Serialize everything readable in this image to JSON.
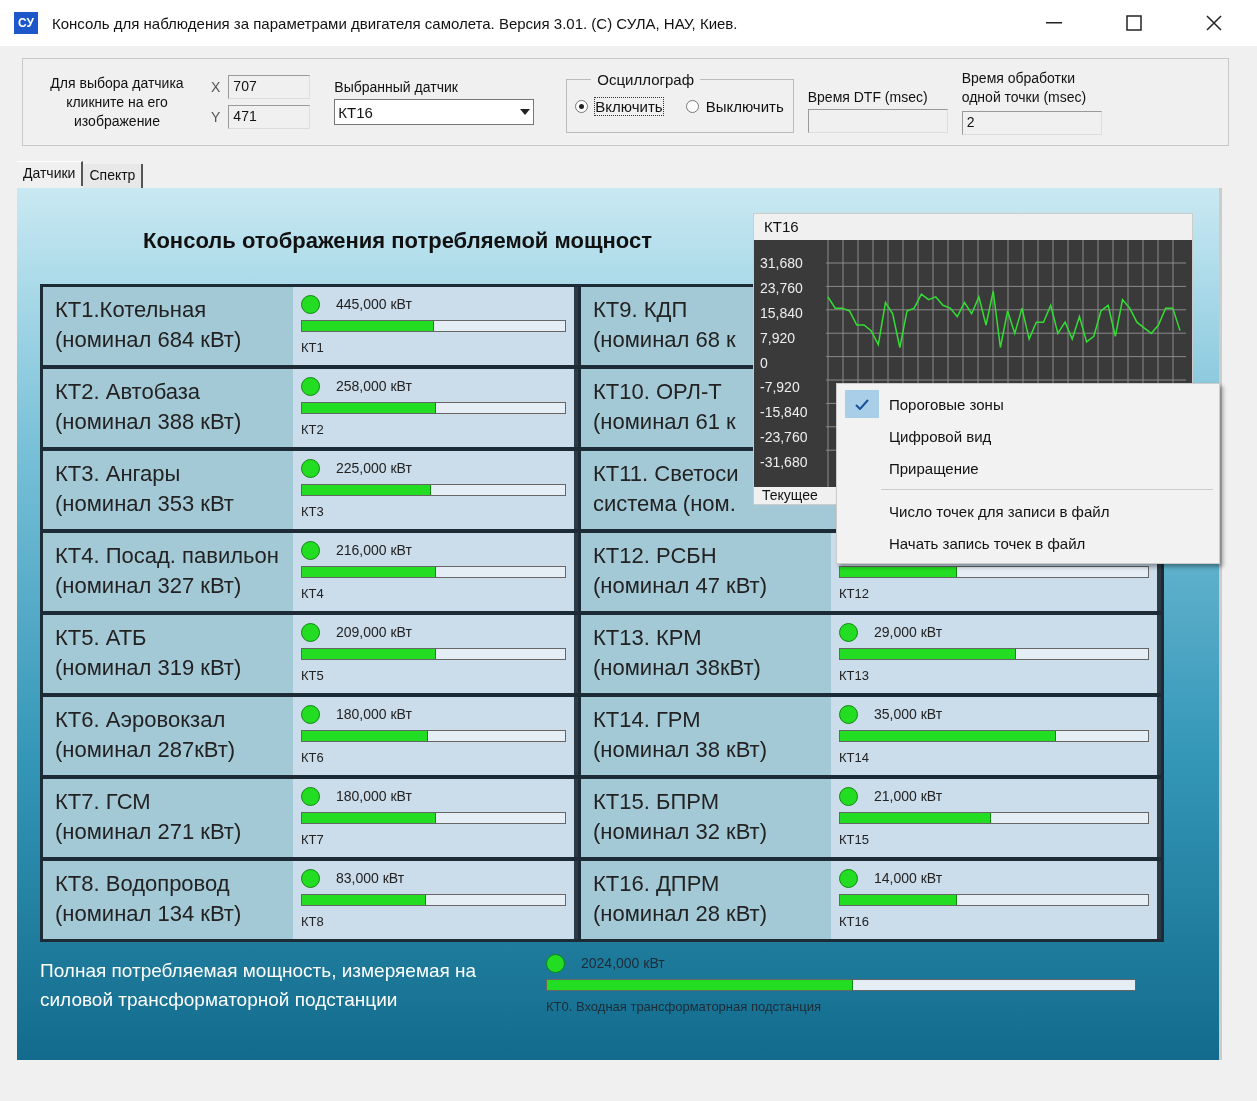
{
  "window": {
    "app_icon_text": "СУ",
    "title": "Консоль для наблюдения за параметрами двигателя самолета. Версия 3.01. (С) СУЛА, НАУ, Киев."
  },
  "controls": {
    "hint": "Для выбора датчика кликните на его изображение",
    "x_label": "X",
    "x_value": "707",
    "y_label": "Y",
    "y_value": "471",
    "sensor_label": "Выбранный датчик",
    "sensor_value": "КТ16",
    "oscillograph": {
      "title": "Осциллограф",
      "options": [
        {
          "label": "Включить",
          "selected": true
        },
        {
          "label": "Выключить",
          "selected": false
        }
      ]
    },
    "dtf_label": "Время DTF (msec)",
    "point_time_label": "Время обработки одной точки (msec)",
    "point_time_value": "2"
  },
  "tabs": [
    {
      "label": "Датчики",
      "selected": true
    },
    {
      "label": "Спектр",
      "selected": false
    }
  ],
  "panel_title": "Консоль отображения потребляемой мощност",
  "sensors_left": [
    {
      "name": "КТ1.Котельная",
      "nominal": "(номинал 684 кВт)",
      "meter": {
        "reading": "445,000 кВт",
        "level": 0.5,
        "tag": "КТ1"
      }
    },
    {
      "name": "КТ2. Автобаза",
      "nominal": "(номинал 388 кВт)",
      "meter": {
        "reading": "258,000 кВт",
        "level": 0.51,
        "tag": "КТ2"
      }
    },
    {
      "name": "КТ3. Ангары",
      "nominal": "(номинал 353 кВт",
      "meter": {
        "reading": "225,000 кВт",
        "level": 0.49,
        "tag": "КТ3"
      }
    },
    {
      "name": "КТ4. Посад. павильон",
      "nominal": "(номинал 327 кВт)",
      "meter": {
        "reading": "216,000 кВт",
        "level": 0.51,
        "tag": "КТ4"
      }
    },
    {
      "name": "КТ5. АТБ",
      "nominal": "(номинал 319 кВт)",
      "meter": {
        "reading": "209,000 кВт",
        "level": 0.51,
        "tag": "КТ5"
      }
    },
    {
      "name": "КТ6. Аэровокзал",
      "nominal": "(номинал 287кВт)",
      "meter": {
        "reading": "180,000 кВт",
        "level": 0.48,
        "tag": "КТ6"
      }
    },
    {
      "name": "КТ7. ГСМ",
      "nominal": "(номинал 271 кВт)",
      "meter": {
        "reading": "180,000 кВт",
        "level": 0.51,
        "tag": "КТ7"
      }
    },
    {
      "name": "КТ8. Водопровод",
      "nominal": "(номинал 134 кВт)",
      "meter": {
        "reading": "83,000 кВт",
        "level": 0.47,
        "tag": "КТ8"
      }
    }
  ],
  "sensors_right": [
    {
      "name": "КТ9. КДП",
      "nominal": "(номинал 68 к"
    },
    {
      "name": "КТ10. ОРЛ-Т",
      "nominal": "(номинал 61 к"
    },
    {
      "name": "КТ11. Светоси",
      "nominal": "система (ном."
    },
    {
      "name": "КТ12. РСБН",
      "nominal": "(номинал 47 кВт)",
      "meter": {
        "level": 0.38,
        "tag": "КТ12"
      }
    },
    {
      "name": "КТ13. КРМ",
      "nominal": "(номинал 38кВт)",
      "meter": {
        "reading": "29,000 кВт",
        "level": 0.57,
        "tag": "КТ13"
      }
    },
    {
      "name": "КТ14. ГРМ",
      "nominal": "(номинал 38 кВт)",
      "meter": {
        "reading": "35,000 кВт",
        "level": 0.7,
        "tag": "КТ14"
      }
    },
    {
      "name": "КТ15. БПРМ",
      "nominal": "(номинал 32 кВт)",
      "meter": {
        "reading": "21,000 кВт",
        "level": 0.49,
        "tag": "КТ15"
      }
    },
    {
      "name": "КТ16. ДПРМ",
      "nominal": "(номинал 28 кВт)",
      "meter": {
        "reading": "14,000 кВт",
        "level": 0.38,
        "tag": "КТ16"
      }
    }
  ],
  "total": {
    "caption": "Полная потребляемая мощность, измеряемая на силовой трансформаторной подстанции",
    "reading": "2024,000 кВт",
    "level": 0.52,
    "tag": "КТ0. Входная трансформаторная подстанция"
  },
  "oscilloscope": {
    "title": "КТ16",
    "y_axis_labels": [
      "31,680",
      "23,760",
      "15,840",
      "7,920",
      "0",
      "-7,920",
      "-15,840",
      "-23,760",
      "-31,680"
    ],
    "footer": "Текущее"
  },
  "context_menu": [
    {
      "kind": "item",
      "label": "Пороговые зоны",
      "checked": true
    },
    {
      "kind": "item",
      "label": "Цифровой вид",
      "checked": false
    },
    {
      "kind": "item",
      "label": "Приращение",
      "checked": false
    },
    {
      "kind": "separator"
    },
    {
      "kind": "item",
      "label": "Число точек для записи в файл",
      "checked": false
    },
    {
      "kind": "item",
      "label": "Начать запись точек в файл",
      "checked": false
    }
  ]
}
